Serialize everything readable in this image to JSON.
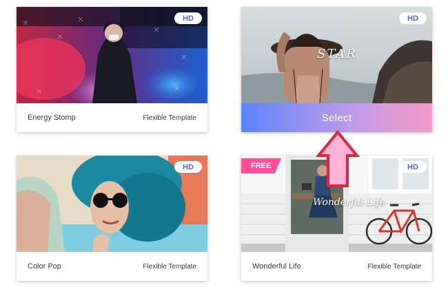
{
  "cards": [
    {
      "title": "Energy Stomp",
      "subtitle": "Flexible Template",
      "badge": "HD"
    },
    {
      "title": "",
      "subtitle": "",
      "badge": "HD",
      "overlay": "STAR",
      "action_label": "Select"
    },
    {
      "title": "Color Pop",
      "subtitle": "Flexible Template",
      "badge": "HD"
    },
    {
      "title": "Wonderful Life",
      "subtitle": "Flexible Template",
      "badge": "HD",
      "ribbon": "FREE",
      "overlay": "Wonderful Life"
    }
  ],
  "colors": {
    "badge_text": "#5566d8",
    "select_gradient_start": "#5a86ff",
    "select_gradient_end": "#f39cc8",
    "free_ribbon": "#ff4f99",
    "arrow_fill": "#ffb3d6",
    "arrow_stroke": "#e0243c"
  },
  "icons": [
    "pointer-arrow-icon"
  ]
}
